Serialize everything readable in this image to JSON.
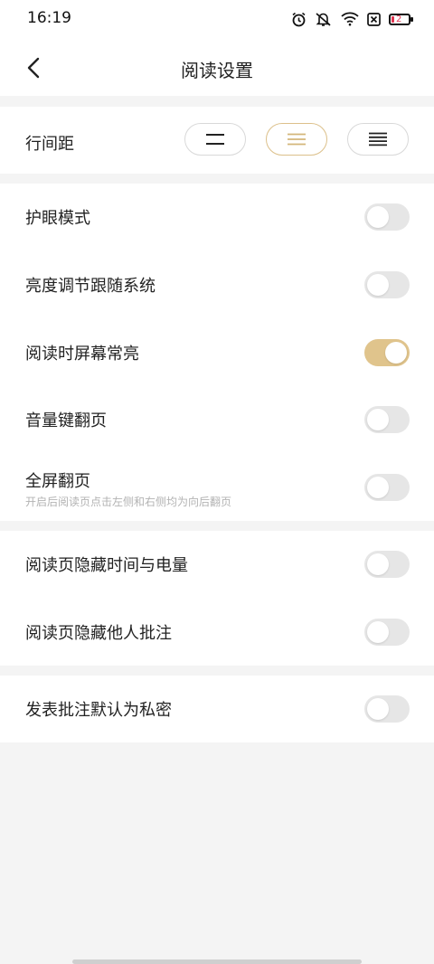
{
  "status_bar": {
    "time": "16:19",
    "battery_level": "2",
    "icons": [
      "alarm-icon",
      "mute-icon",
      "wifi-icon",
      "no-sim-icon",
      "battery-icon"
    ]
  },
  "nav": {
    "title": "阅读设置",
    "back_icon": "chevron-left-icon"
  },
  "line_spacing": {
    "label": "行间距",
    "options": [
      "compact",
      "medium",
      "loose"
    ],
    "selected": "medium",
    "accent_color": "#dcc08a"
  },
  "group1": [
    {
      "label": "护眼模式",
      "on": false
    },
    {
      "label": "亮度调节跟随系统",
      "on": false
    },
    {
      "label": "阅读时屏幕常亮",
      "on": true
    },
    {
      "label": "音量键翻页",
      "on": false
    },
    {
      "label": "全屏翻页",
      "sub": "开启后阅读页点击左侧和右侧均为向后翻页",
      "on": false
    }
  ],
  "group2": [
    {
      "label": "阅读页隐藏时间与电量",
      "on": false
    },
    {
      "label": "阅读页隐藏他人批注",
      "on": false
    }
  ],
  "group3": [
    {
      "label": "发表批注默认为私密",
      "on": false
    }
  ],
  "colors": {
    "toggle_on": "#e0c48c",
    "toggle_off": "#e6e6e6",
    "background": "#f4f4f4"
  }
}
